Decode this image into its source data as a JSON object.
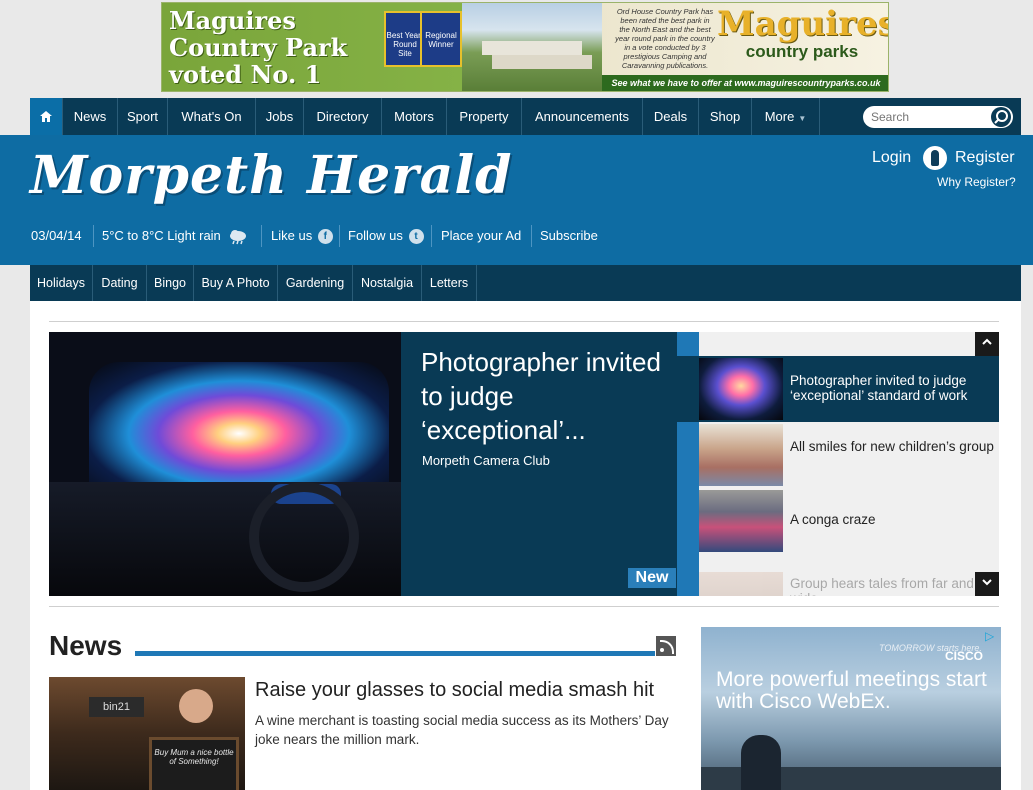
{
  "top_ad": {
    "headline": "Maguires Country Park voted No. 1",
    "award1": "Best Year-Round Site",
    "award2": "Regional Winner",
    "desc": "Ord House Country Park has been rated the best park in the North East and the best year round park in the country in a vote conducted by 3 prestigious Camping and Caravanning publications.",
    "brand": "Maguires",
    "brand_sub": "country parks",
    "footer": "See what we have to offer at www.maguirescountryparks.co.uk"
  },
  "nav": {
    "items": [
      "News",
      "Sport",
      "What's On",
      "Jobs",
      "Directory",
      "Motors",
      "Property",
      "Announcements",
      "Deals",
      "Shop",
      "More"
    ],
    "search_placeholder": "Search"
  },
  "masthead": {
    "logo": "Morpeth Herald",
    "login": "Login",
    "register": "Register",
    "why_register": "Why Register?",
    "date": "03/04/14",
    "weather": "5°C to 8°C Light rain",
    "like_us": "Like us",
    "follow_us": "Follow us",
    "place_ad": "Place your Ad",
    "subscribe": "Subscribe"
  },
  "subnav": {
    "items": [
      "Holidays",
      "Dating",
      "Bingo",
      "Buy A Photo",
      "Gardening",
      "Nostalgia",
      "Letters"
    ]
  },
  "hero": {
    "headline": "Photographer invited to judge ‘exceptional’...",
    "sub": "Morpeth Camera Club",
    "badge": "New"
  },
  "side_list": [
    {
      "title": "Photographer invited to judge ‘exceptional’ standard of work"
    },
    {
      "title": "All smiles for new children’s group"
    },
    {
      "title": "A conga craze"
    },
    {
      "title": "Group hears tales from far and wide"
    }
  ],
  "news": {
    "section_title": "News",
    "article_title": "Raise your glasses to social media smash hit",
    "article_desc": "A wine merchant is toasting social media success as its Mothers’ Day joke nears the million mark.",
    "image_sign": "bin21",
    "image_board": "Buy Mum a nice bottle of Something!"
  },
  "right_ad": {
    "text": "More powerful meetings start with Cisco WebEx.",
    "tomorrow": "TOMORROW starts here.",
    "brand": "CISCO"
  }
}
